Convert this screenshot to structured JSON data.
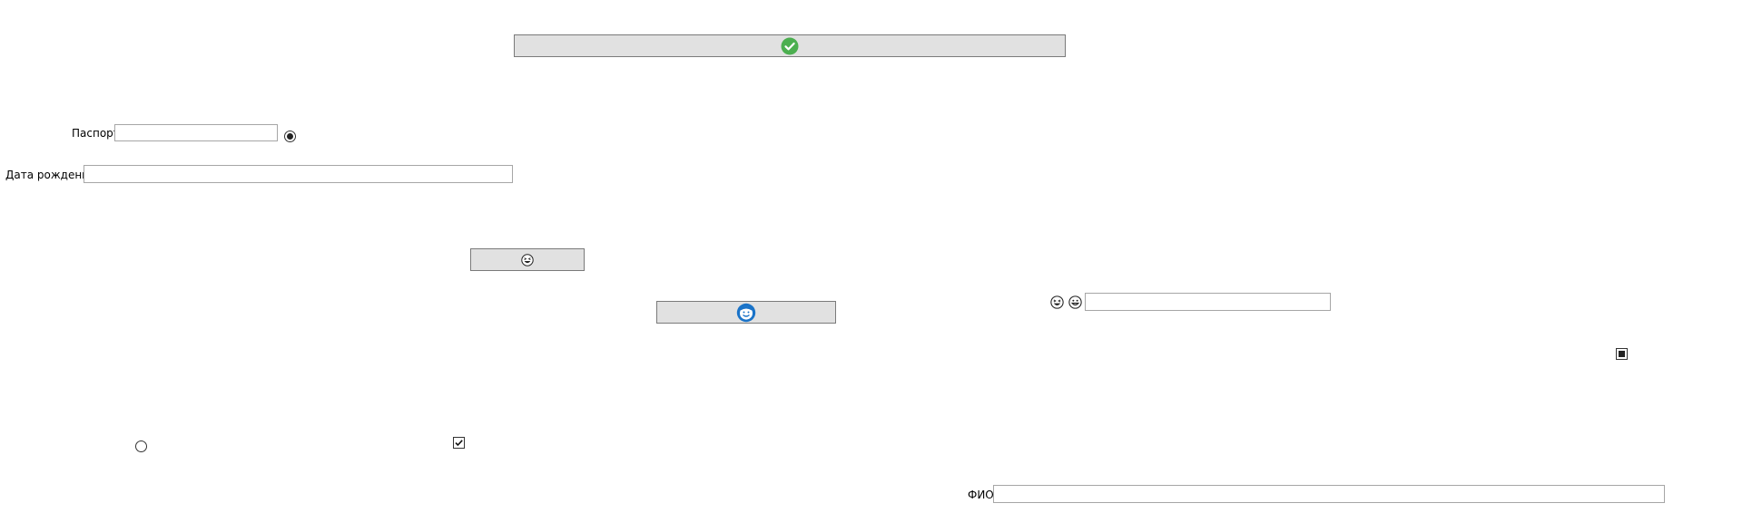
{
  "buttons": {
    "top": {
      "icon": "green-check-circle-icon"
    },
    "middle": {
      "icon": "grinning-squint-face-icon"
    },
    "lower": {
      "icon": "blue-face-circle-icon"
    }
  },
  "fields": {
    "passport": {
      "label": "Паспорт",
      "value": ""
    },
    "birth_date": {
      "label": "Дата рождения",
      "value": ""
    },
    "emoji_field": {
      "value": ""
    },
    "fio": {
      "label": "ФИО",
      "value": ""
    }
  },
  "controls": {
    "radio_passport": {
      "checked": true
    },
    "radio_bottom": {
      "checked": false
    },
    "checkbox_bottom": {
      "checked": true
    },
    "checkbox_right": {
      "state": "indeterminate"
    }
  },
  "icons": {
    "emoji_left": "grinning-squint-face-icon",
    "emoji_right": "grinning-face-icon"
  },
  "colors": {
    "button_bg": "#e1e1e1",
    "button_border": "#7a7a7a",
    "field_border": "#a6a6a6",
    "check_green": "#4caf50",
    "face_blue": "#1a73c8"
  }
}
